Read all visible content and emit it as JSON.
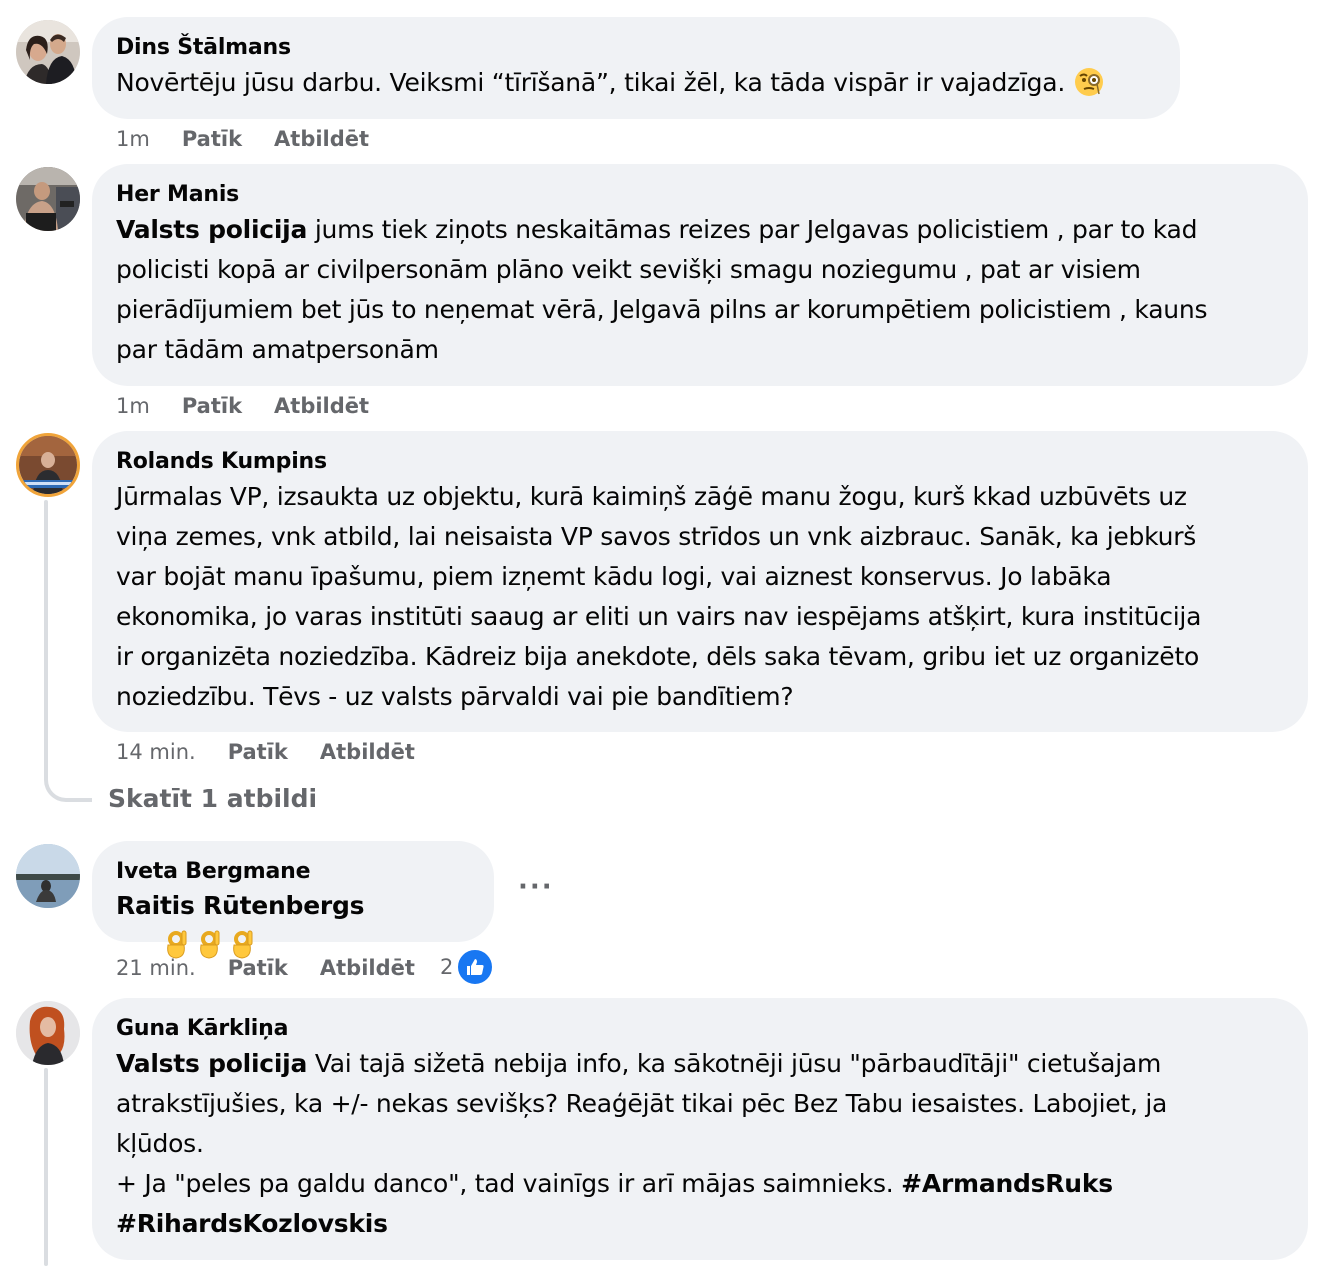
{
  "comments": [
    {
      "author": "Dins Štālmans",
      "text": "Novērtēju jūsu darbu. Veiksmi “tīrīšanā”, tikai žēl, ka tāda vispār ir vajadzīga.",
      "emoji": "face-with-monocle-emoji",
      "time": "1m",
      "like_label": "Patīk",
      "reply_label": "Atbildēt"
    },
    {
      "author": "Her Manis",
      "mention": "Valsts policija",
      "text": " jums tiek ziņots neskaitāmas reizes par Jelgavas policistiem , par to kad\npolicisti kopā ar civilpersonām plāno veikt sevišķi smagu noziegumu , pat ar visiem\npierādījumiem bet jūs to neņemat vērā, Jelgavā pilns ar korumpētiem policistiem , kauns\npar tādām amatpersonām",
      "time": "1m",
      "like_label": "Patīk",
      "reply_label": "Atbildēt"
    },
    {
      "author": "Rolands Kumpins",
      "text": "Jūrmalas VP, izsaukta uz objektu, kurā kaimiņš zāģē manu žogu, kurš kkad uzbūvēts uz\nviņa zemes, vnk atbild, lai neisaista VP savos strīdos un vnk aizbrauc. Sanāk, ka jebkurš\nvar bojāt manu īpašumu, piem izņemt kādu logi, vai aiznest konservus. Jo labāka\nekonomika, jo varas institūti saaug ar eliti un vairs nav iespējams atšķirt, kura institūcija\nir organizēta noziedzība. Kādreiz bija anekdote, dēls saka tēvam, gribu iet uz organizēto\nnoziedzību. Tēvs - uz valsts pārvaldi vai pie bandītiem?",
      "time": "14 min.",
      "like_label": "Patīk",
      "reply_label": "Atbildēt",
      "view_replies": "Skatīt 1 atbildi"
    },
    {
      "author": "Iveta Bergmane",
      "mention": "Raitis Rūtenbergs",
      "emoji": "ok-hand-emoji",
      "more_label": "···",
      "time": "21 min.",
      "like_label": "Patīk",
      "reply_label": "Atbildēt",
      "reaction_count": "2",
      "reaction_icon": "like-thumb-icon"
    },
    {
      "author": "Guna Kārkliņa",
      "mention": "Valsts policija",
      "text": " Vai tajā sižetā nebija info, ka sākotnēji jūsu \"pārbaudītāji\" cietušajam\natrakstījušies, ka +/- nekas sevišķs? Reaģējāt tikai pēc Bez Tabu iesaistes. Labojiet, ja\nkļūdos.\n+ Ja \"peles pa galdu danco\", tad vainīgs ir arī mājas saimnieks. ",
      "hashtag1": "#ArmandsRuks",
      "hashtag2": "#RihardsKozlovskis"
    }
  ],
  "colors": {
    "bubble": "#f0f2f5",
    "meta": "#65676b",
    "like_blue": "#1877f2",
    "thread_line": "#dadde1"
  }
}
